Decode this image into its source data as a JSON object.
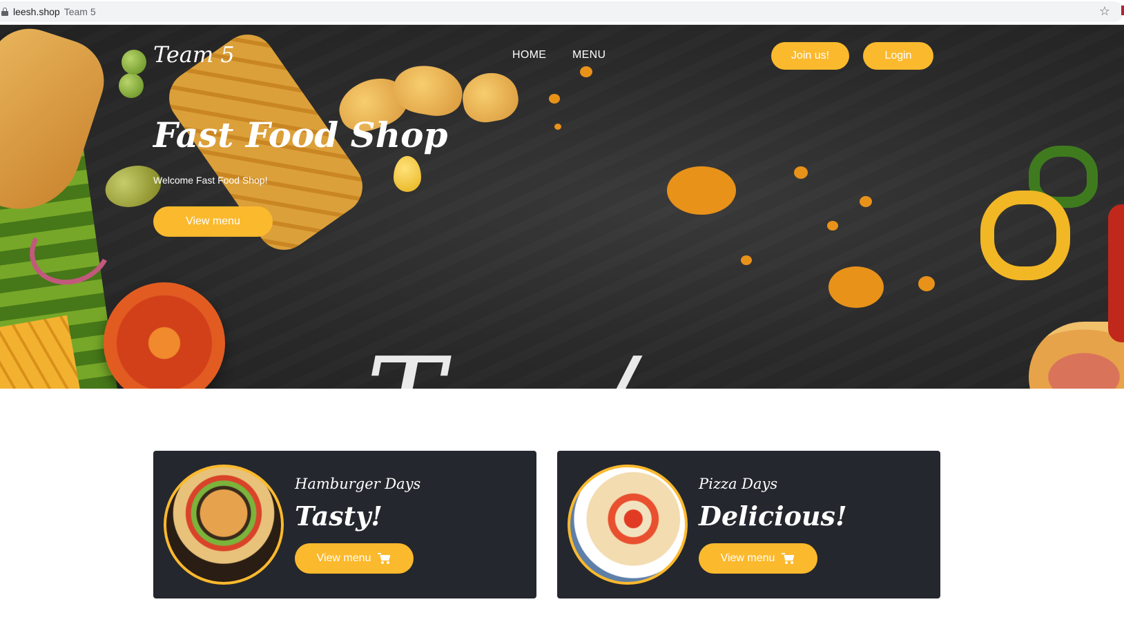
{
  "browser": {
    "host": "leesh.shop",
    "tab_title": "Team 5"
  },
  "nav": {
    "brand": "Team 5",
    "links": [
      "HOME",
      "MENU"
    ],
    "join_label": "Join us!",
    "login_label": "Login"
  },
  "hero": {
    "title": "Fast Food Shop",
    "subtitle": "Welcome Fast Food Shop!",
    "button_label": "View menu"
  },
  "cards": [
    {
      "kicker": "Hamburger Days",
      "headline": "Tasty!",
      "button_label": "View menu",
      "photo": "hamburger"
    },
    {
      "kicker": "Pizza Days",
      "headline": "Delicious!",
      "button_label": "View menu",
      "photo": "pizza"
    }
  ],
  "colors": {
    "accent": "#fbb92d",
    "card_bg": "#24272e",
    "hero_bg": "#2b2b2b"
  }
}
